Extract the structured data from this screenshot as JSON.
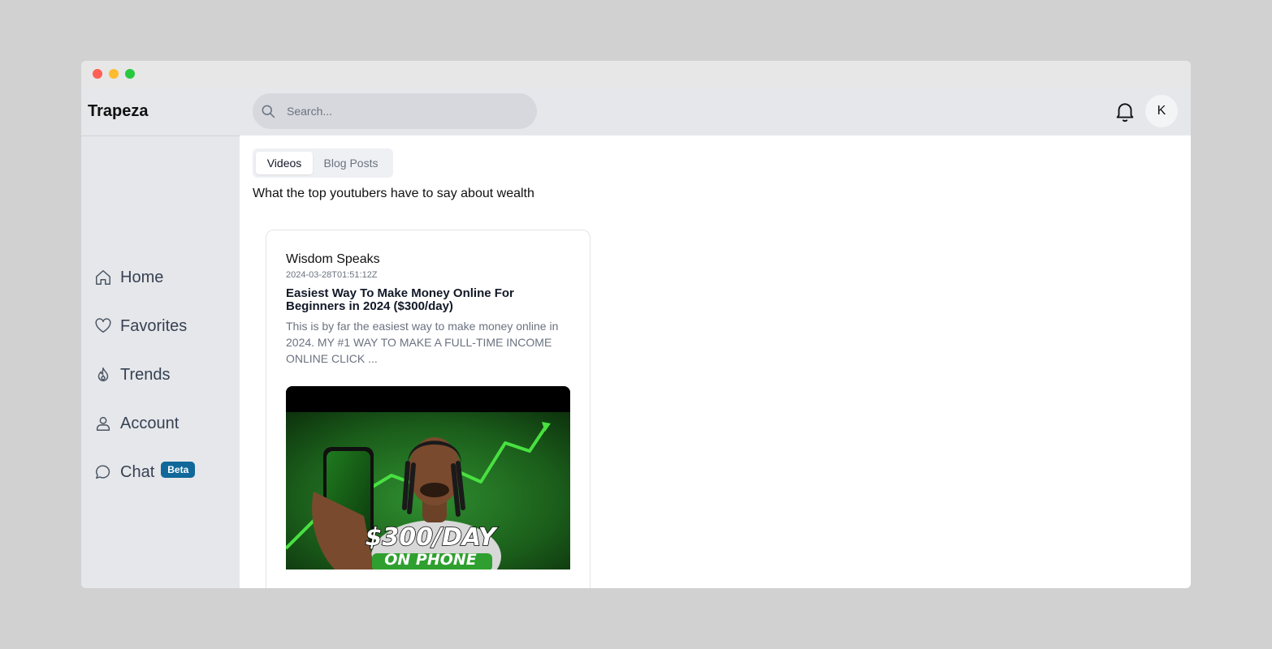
{
  "app": {
    "brand": "Trapeza"
  },
  "sidebar": {
    "items": [
      {
        "label": "Home",
        "icon": "home-icon"
      },
      {
        "label": "Favorites",
        "icon": "heart-icon"
      },
      {
        "label": "Trends",
        "icon": "flame-icon"
      },
      {
        "label": "Account",
        "icon": "user-icon"
      },
      {
        "label": "Chat",
        "icon": "chat-icon",
        "badge": "Beta"
      }
    ]
  },
  "header": {
    "search_placeholder": "Search...",
    "avatar_initial": "K",
    "notification_icon": "bell-icon"
  },
  "main": {
    "tabs": [
      {
        "label": "Videos",
        "active": true
      },
      {
        "label": "Blog Posts",
        "active": false
      }
    ],
    "subtitle": "What the top youtubers have to say about wealth",
    "videos": [
      {
        "channel": "Wisdom Speaks",
        "date": "2024-03-28T01:51:12Z",
        "title": "Easiest Way To Make Money Online For Beginners in 2024 ($300/day)",
        "description": "This is by far the easiest way to make money online in 2024. MY #1 WAY TO MAKE A FULL-TIME INCOME ONLINE CLICK ...",
        "thumbnail_text_1": "$300/DAY",
        "thumbnail_text_2": "ON PHONE"
      }
    ]
  },
  "colors": {
    "sidebar_bg": "#e5e7eb",
    "badge": "#10699a",
    "thumbnail_green": "#1f7a1f"
  }
}
